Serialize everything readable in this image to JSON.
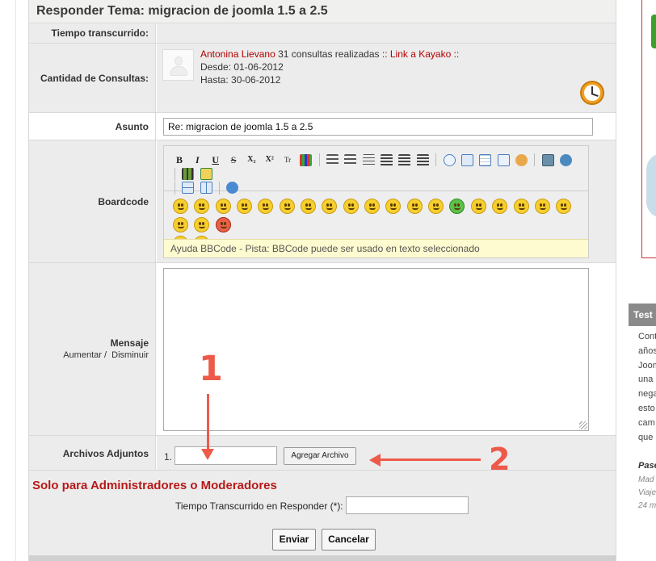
{
  "form": {
    "title": "Responder Tema: migracion de joomla 1.5 a 2.5",
    "tiempo_label": "Tiempo transcurrido:",
    "consultas_label": "Cantidad de Consultas:",
    "consultas_user": "Antonina Lievano",
    "consultas_count": "31 consultas realizadas",
    "kayako_link": ":: Link a Kayako ::",
    "desde": "Desde: 01-06-2012",
    "hasta": "Hasta: 30-06-2012",
    "asunto_label": "Asunto",
    "asunto_value": "Re: migracion de joomla 1.5 a 2.5",
    "boardcode_label": "Boardcode",
    "bb_help": "Ayuda BBCode - Pista: BBCode puede ser usado en texto seleccionado",
    "mensaje_label": "Mensaje",
    "aumentar": "Aumentar /",
    "disminuir": "Disminuir",
    "adjuntos_label": "Archivos Adjuntos",
    "adjunto_num": "1.",
    "agregar_btn": "Agregar Archivo",
    "admin_title": "Solo para Administradores o Moderadores",
    "tiempo_resp_label": "Tiempo Transcurrido en Responder (*):",
    "enviar_btn": "Enviar",
    "cancelar_btn": "Cancelar"
  },
  "toolbar": {
    "bold": "B",
    "italic": "I",
    "underline": "U",
    "strike": "S",
    "sub": "X₂",
    "sup": "X²",
    "tt": "Tr"
  },
  "annotations": {
    "one": "1",
    "two": "2"
  },
  "sidebar": {
    "heading": "Test",
    "lines": [
      "Cont",
      "años",
      "Joom",
      "una",
      "nega",
      "esto",
      "cam",
      "que"
    ],
    "author": "Pase",
    "meta": [
      "Mad",
      "Viaje",
      "24 m"
    ]
  },
  "colors": {
    "admin_red": "#b81818",
    "annotation": "#ee5a4a",
    "link_red": "#b30000"
  }
}
